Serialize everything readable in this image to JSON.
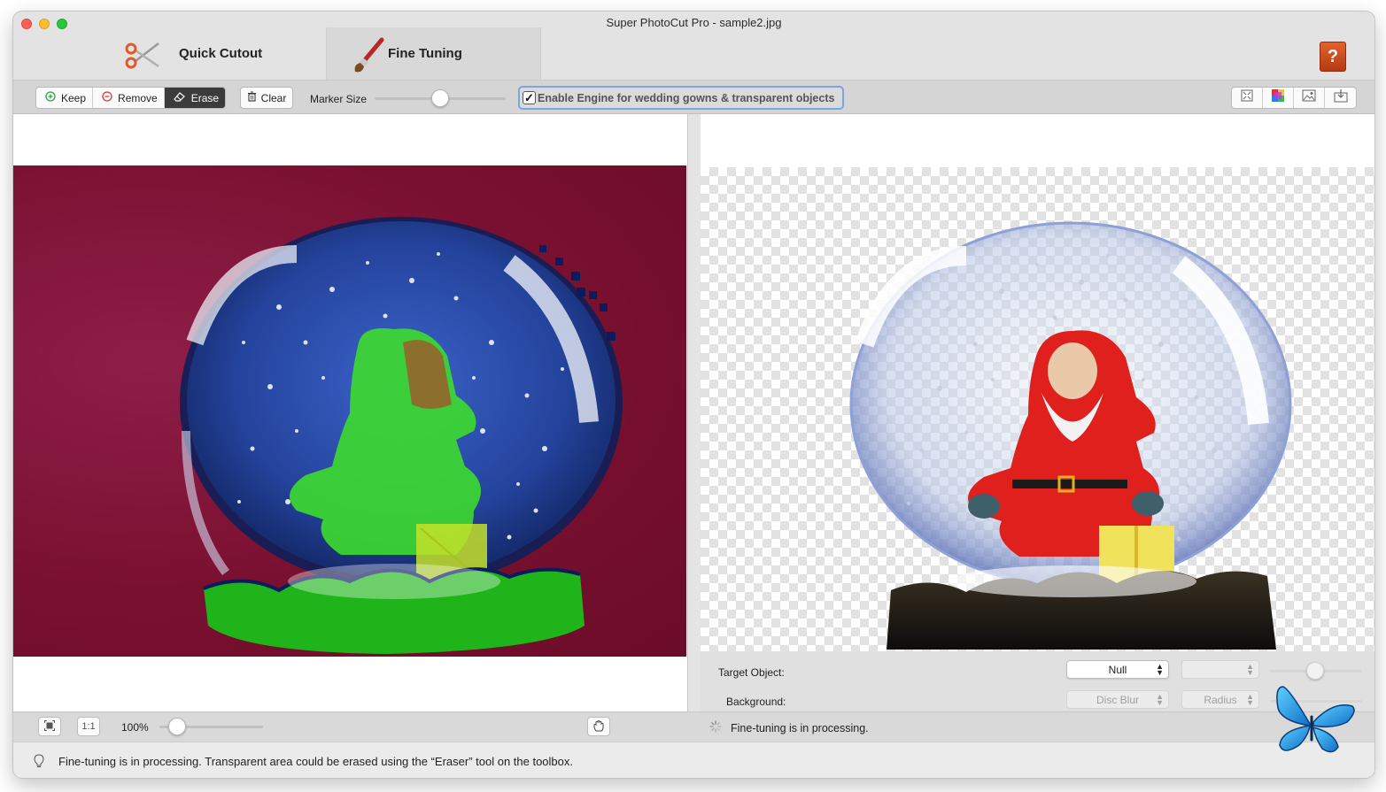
{
  "window": {
    "title": "Super PhotoCut Pro - sample2.jpg"
  },
  "tabs": [
    {
      "label": "Quick Cutout",
      "icon": "scissors-icon",
      "active": false
    },
    {
      "label": "Fine Tuning",
      "icon": "paintbrush-icon",
      "active": true
    }
  ],
  "help": {
    "label": "?"
  },
  "toolbar": {
    "modes": [
      {
        "label": "Keep",
        "icon": "plus-circle-icon",
        "color": "#2ea043"
      },
      {
        "label": "Remove",
        "icon": "minus-circle-icon",
        "color": "#d93a3a"
      },
      {
        "label": "Erase",
        "icon": "eraser-icon",
        "active": true
      }
    ],
    "clear_label": "Clear",
    "marker_label": "Marker Size",
    "marker_value": 0.5,
    "engine_checked": true,
    "engine_label": "Enable Engine for wedding gowns & transparent objects",
    "view_icons": [
      "fit-icon",
      "color-icon",
      "image-icon",
      "export-icon"
    ]
  },
  "right_controls": {
    "target_label": "Target Object:",
    "target_value": "Null",
    "background_label": "Background:",
    "background_value": "Disc Blur",
    "radius_value": "Radius"
  },
  "bottom": {
    "fit_icon": "fit-screen-icon",
    "actual_size_label": "1:1",
    "zoom_label": "100%",
    "zoom_value": 0.15,
    "processing_text": "Fine-tuning is in processing."
  },
  "status": {
    "text": "Fine-tuning is in processing. Transparent area could be erased using the “Eraser” tool on the toolbox."
  },
  "colors": {
    "accent": "#7aa6e8",
    "background_photo": "#7a1030",
    "keep_overlay": "#3ddc2e"
  }
}
